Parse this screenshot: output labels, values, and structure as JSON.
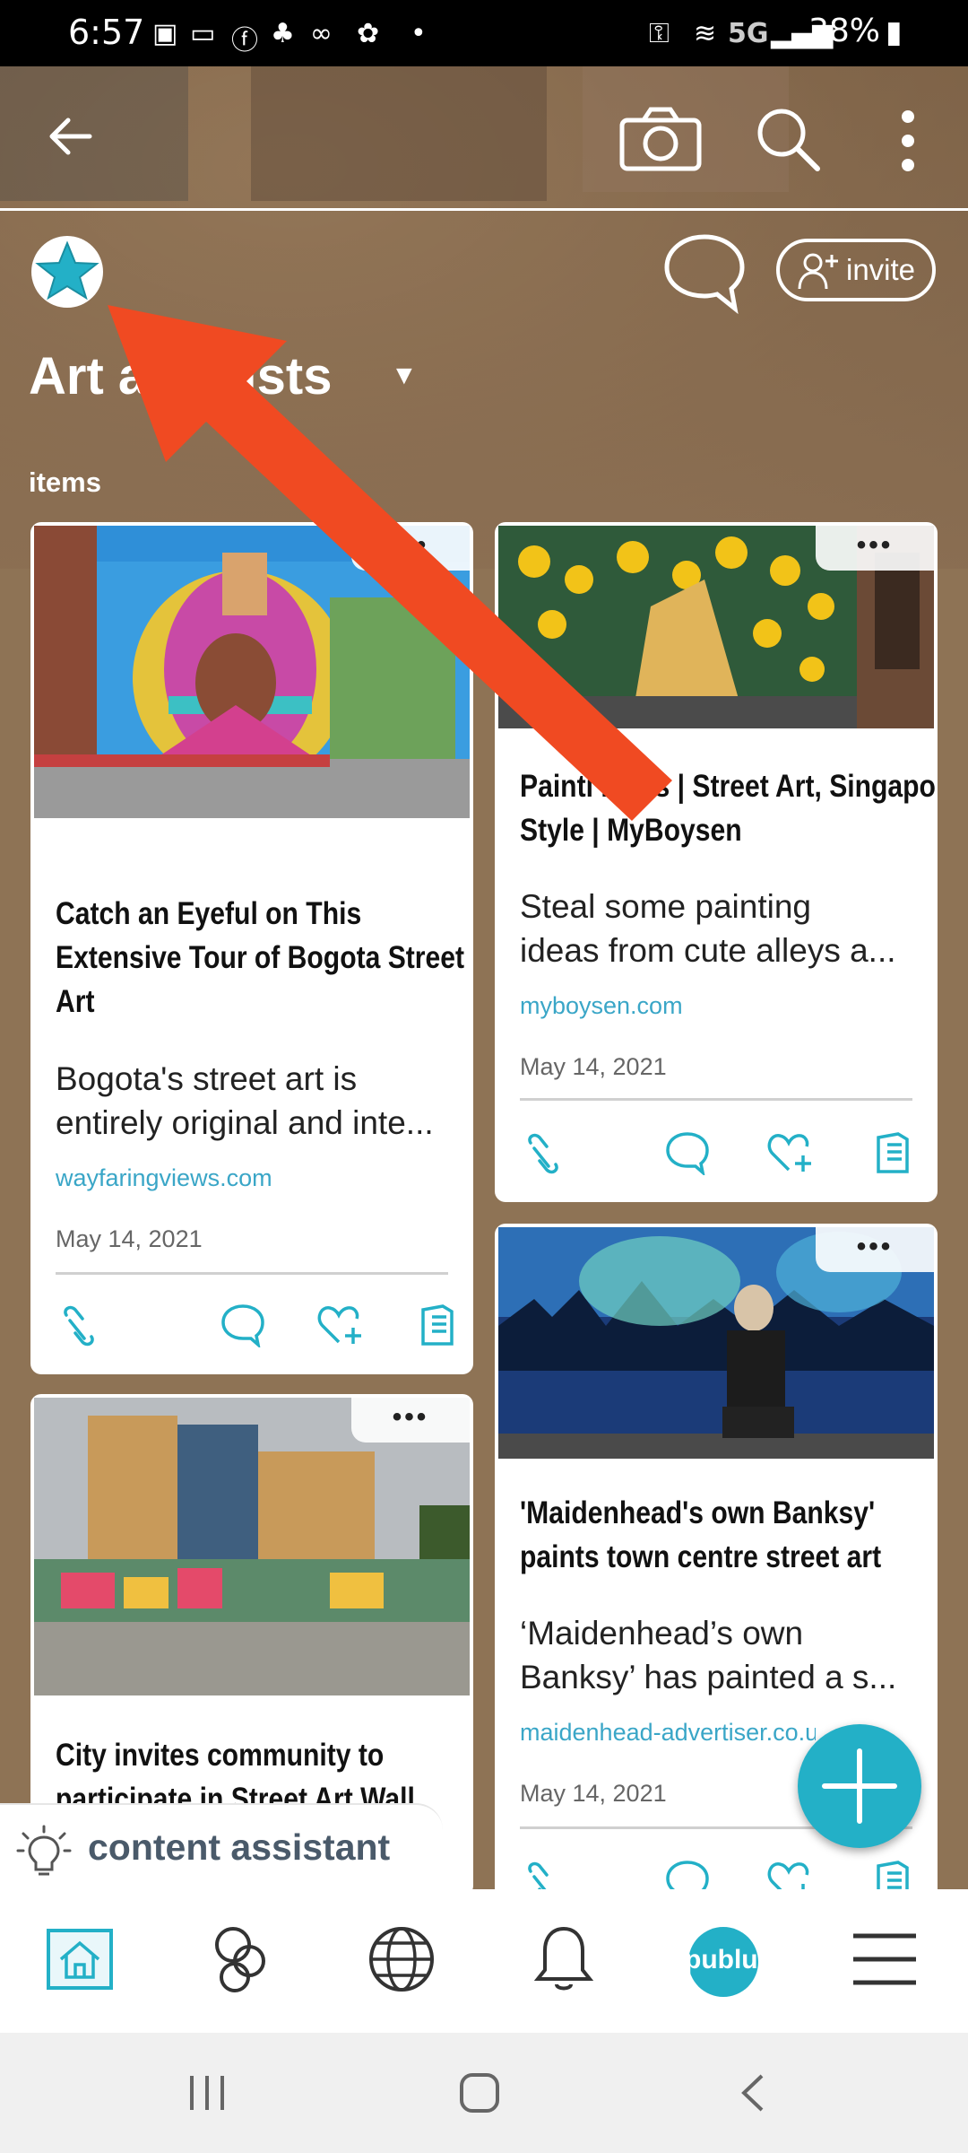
{
  "status_bar": {
    "time": "6:57",
    "network": "5G",
    "battery": "38%"
  },
  "board": {
    "title": "Art a  artists",
    "section_label": "items",
    "invite_label": "invite"
  },
  "cards": [
    {
      "title": "Catch an Eyeful on This Extensive Tour of Bogota Street Art",
      "desc_line1": "Bogota's street art is",
      "desc_line2": "entirely original and inte...",
      "source": "wayfaringviews.com",
      "date": "May 14, 2021",
      "more": "•••"
    },
    {
      "title": "Painti  Ideas | Street Art, Singapo  Style | MyBoysen",
      "desc_line1": "Steal some painting",
      "desc_line2": "ideas from cute alleys a...",
      "source": "myboysen.com",
      "date": "May 14, 2021",
      "more": "•••"
    },
    {
      "title": "City invites community to participate in Street Art Wall",
      "more": "•••"
    },
    {
      "title": "'Maidenhead's own Banksy' paints town centre street art",
      "desc_line1": "‘Maidenhead’s own",
      "desc_line2": "Banksy’ has painted a s...",
      "source": "maidenhead-advertiser.co.u",
      "date": "May 14, 2021",
      "more": "•••"
    }
  ],
  "content_assistant": {
    "label": "content assistant"
  },
  "bottom_nav": {
    "profile_badge": "publup"
  },
  "colors": {
    "accent": "#23b0c7",
    "link": "#3aa6c7",
    "arrow": "#f04a22"
  }
}
